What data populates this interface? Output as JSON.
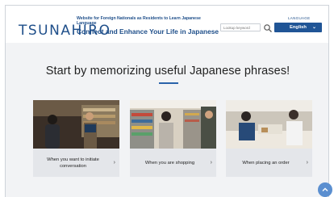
{
  "header": {
    "logo_text": "TSUNAHIRO",
    "tagline_small": "Website for Foreign Nationals as Residents to Learn Japanese Language",
    "tagline_big": "Connect and Enhance Your Life in Japanese",
    "search_placeholder": "Lookup keyword",
    "language_label": "LANGUAGE",
    "language_value": "English",
    "accent_color": "#205596"
  },
  "hero": {
    "headline": "Start by memorizing useful Japanese phrases!"
  },
  "cards": [
    {
      "label": "When you want to initiate conversation"
    },
    {
      "label": "When you are shopping"
    },
    {
      "label": "When placing an order"
    }
  ]
}
